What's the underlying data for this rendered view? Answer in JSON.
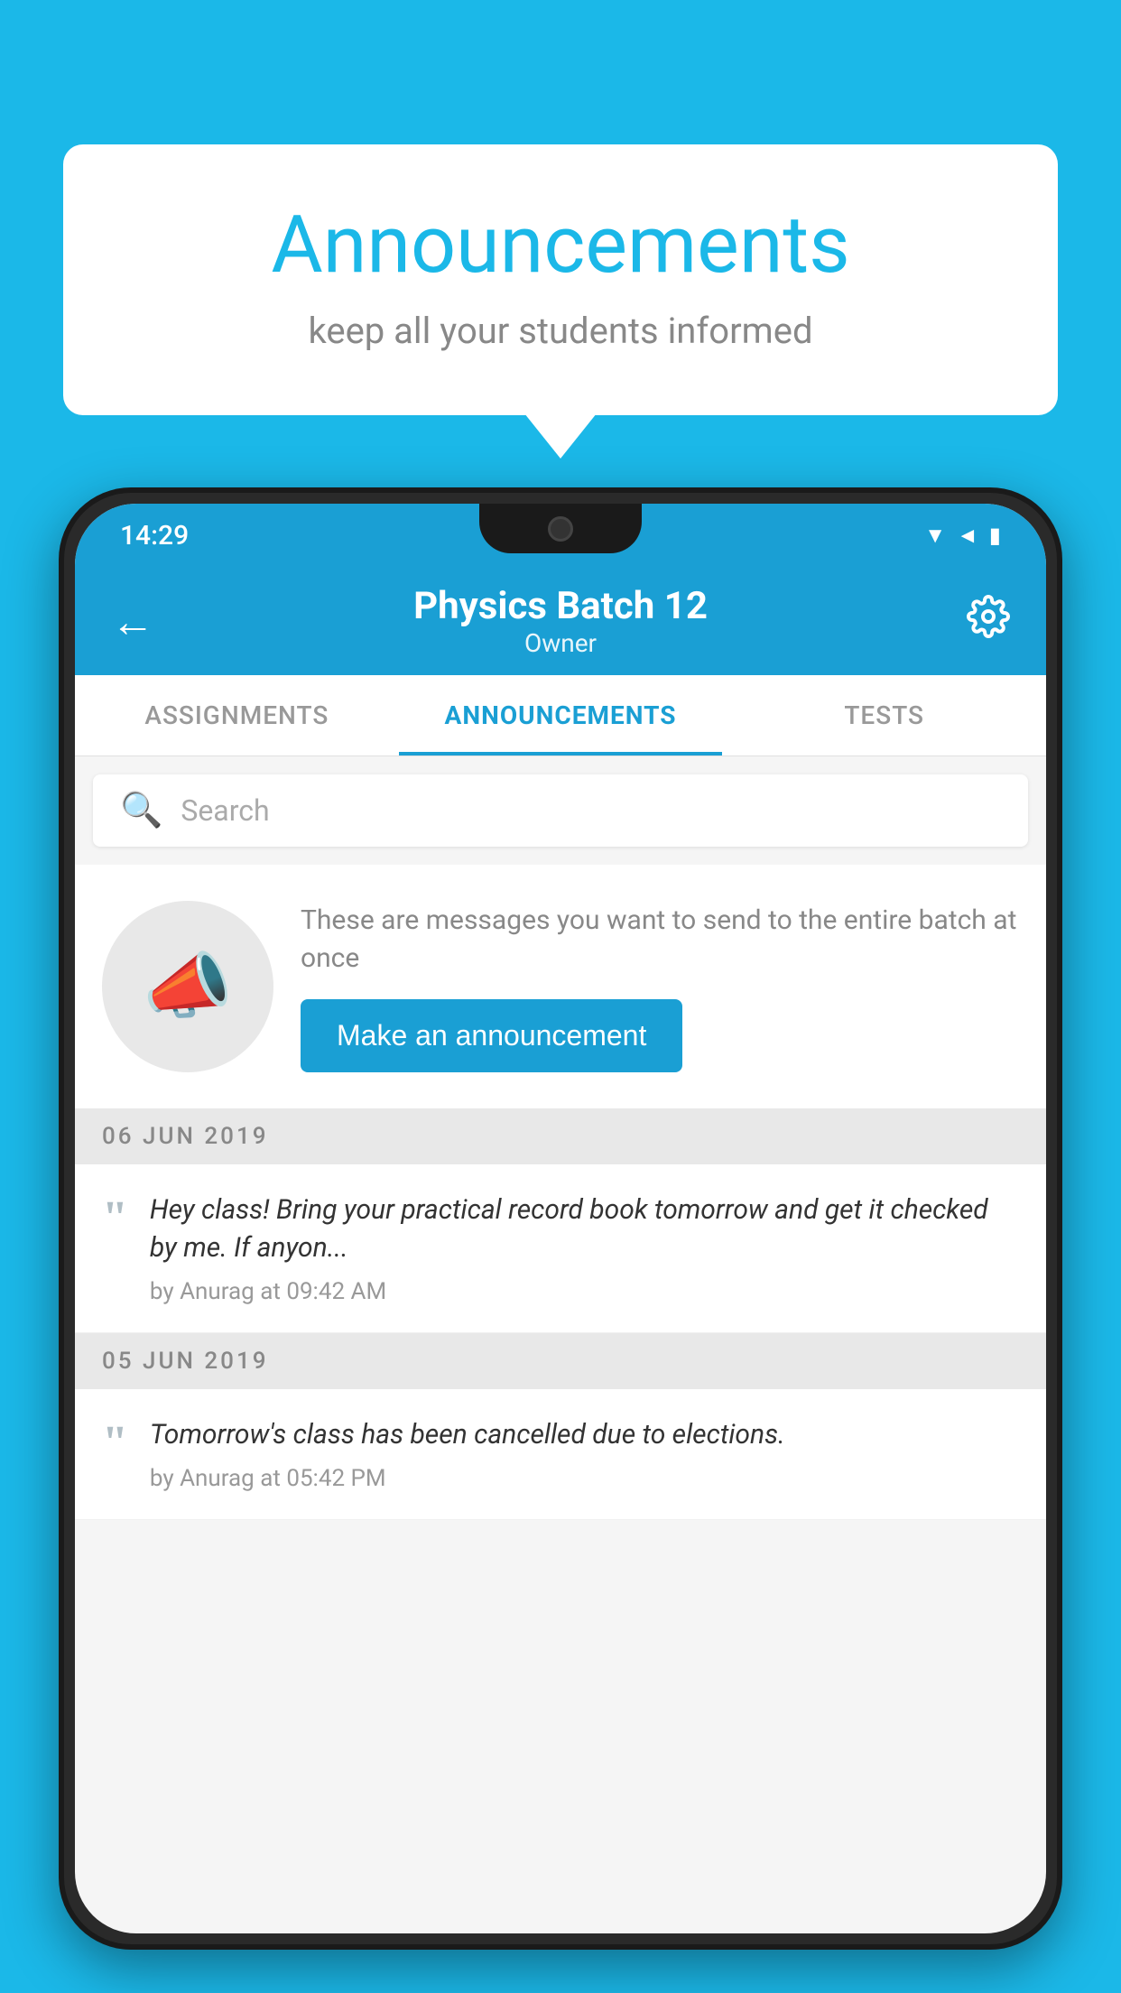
{
  "background_color": "#1bb8e8",
  "speech_bubble": {
    "title": "Announcements",
    "subtitle": "keep all your students informed"
  },
  "status_bar": {
    "time": "14:29",
    "icons": [
      "wifi",
      "signal",
      "battery"
    ]
  },
  "app_bar": {
    "title": "Physics Batch 12",
    "subtitle": "Owner",
    "back_label": "←",
    "settings_label": "⚙"
  },
  "tabs": [
    {
      "label": "ASSIGNMENTS",
      "active": false
    },
    {
      "label": "ANNOUNCEMENTS",
      "active": true
    },
    {
      "label": "TESTS",
      "active": false
    }
  ],
  "search": {
    "placeholder": "Search"
  },
  "cta": {
    "description": "These are messages you want to send to the entire batch at once",
    "button_label": "Make an announcement"
  },
  "announcements": [
    {
      "date": "06  JUN  2019",
      "items": [
        {
          "text": "Hey class! Bring your practical record book tomorrow and get it checked by me. If anyon...",
          "meta": "by Anurag at 09:42 AM"
        }
      ]
    },
    {
      "date": "05  JUN  2019",
      "items": [
        {
          "text": "Tomorrow's class has been cancelled due to elections.",
          "meta": "by Anurag at 05:42 PM"
        }
      ]
    }
  ]
}
